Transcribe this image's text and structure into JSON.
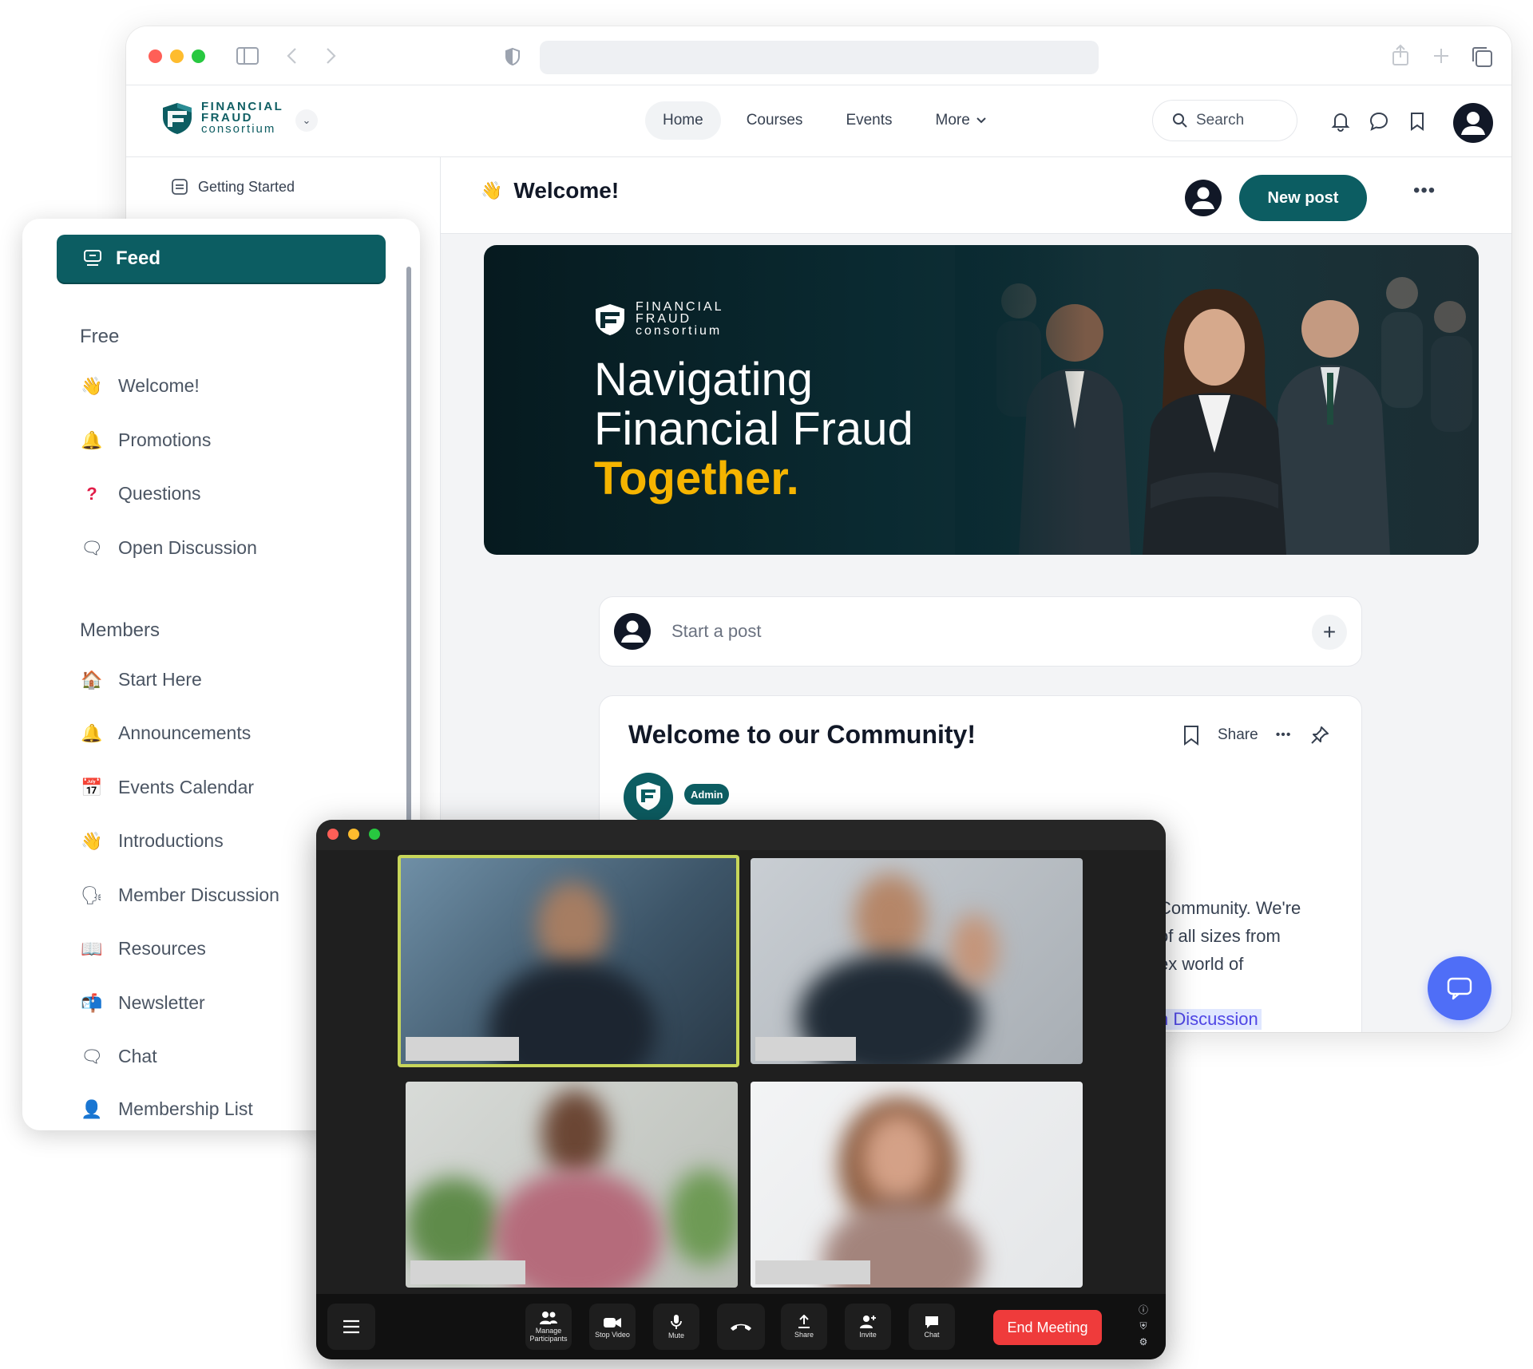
{
  "browser": {
    "brand": {
      "line1": "FINANCIAL",
      "line2": "FRAUD",
      "line3": "consortium"
    },
    "nav": {
      "home": "Home",
      "courses": "Courses",
      "events": "Events",
      "more": "More",
      "search_placeholder": "Search"
    },
    "sidebar_top_item": "Getting Started",
    "page_title": "Welcome!",
    "new_post_label": "New post",
    "hero": {
      "title_line1": "Navigating",
      "title_line2": "Financial Fraud",
      "title_highlight": "Together."
    },
    "composer_placeholder": "Start a post",
    "post": {
      "title": "Welcome to our Community!",
      "share_label": "Share",
      "author_badge": "Admin",
      "body_line1": "Community. We're",
      "body_line2": "of all sizes from",
      "body_line3": "ex world of",
      "link_text": "n Discussion"
    }
  },
  "sidebar": {
    "feed_label": "Feed",
    "sections": [
      {
        "title": "Free",
        "items": [
          {
            "label": "Welcome!",
            "icon": "waving-hand-icon"
          },
          {
            "label": "Promotions",
            "icon": "bell-icon"
          },
          {
            "label": "Questions",
            "icon": "question-mark-icon"
          },
          {
            "label": "Open Discussion",
            "icon": "speech-bubble-icon"
          }
        ]
      },
      {
        "title": "Members",
        "items": [
          {
            "label": "Start Here",
            "icon": "house-icon"
          },
          {
            "label": "Announcements",
            "icon": "bell-icon"
          },
          {
            "label": "Events Calendar",
            "icon": "calendar-icon"
          },
          {
            "label": "Introductions",
            "icon": "waving-hand-icon"
          },
          {
            "label": "Member Discussion",
            "icon": "speaking-head-icon"
          },
          {
            "label": "Resources",
            "icon": "book-icon"
          },
          {
            "label": "Newsletter",
            "icon": "mailbox-icon"
          },
          {
            "label": "Chat",
            "icon": "speech-bubble-icon"
          },
          {
            "label": "Membership List",
            "icon": "person-icon"
          }
        ]
      }
    ]
  },
  "call": {
    "toolbar": {
      "manage": "Manage Participants",
      "stop_video": "Stop Video",
      "mute": "Mute",
      "share": "Share",
      "invite": "Invite",
      "chat": "Chat",
      "end": "End Meeting"
    }
  },
  "colors": {
    "brand_teal": "#0c5d62",
    "accent_gold": "#f5b400",
    "chat_fab": "#4f6ef7",
    "end_meeting": "#ef3b3b",
    "active_speaker": "#c7d65a"
  }
}
